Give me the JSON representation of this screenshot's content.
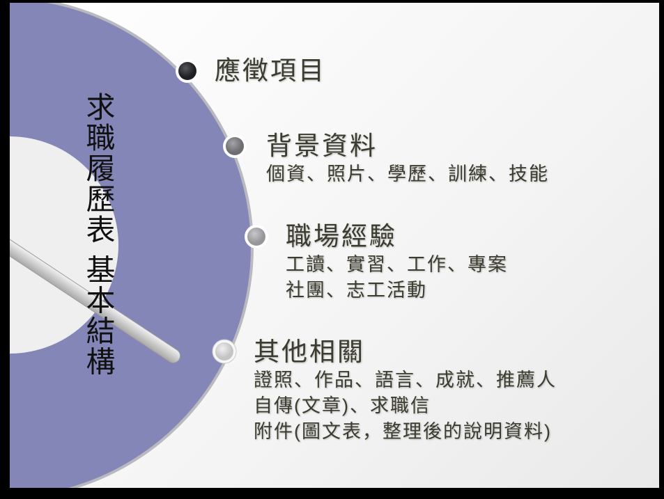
{
  "slide": {
    "vertical_title": "求職履歷表 基本結構",
    "items": [
      {
        "heading": "應徵項目",
        "lines": [],
        "dot_color": "#2a2b30"
      },
      {
        "heading": "背景資料",
        "lines": [
          "個資、照片、學歷、訓練、技能"
        ],
        "dot_color": "#7c7b80"
      },
      {
        "heading": "職場經驗",
        "lines": [
          "工讀、實習、工作、專案",
          "社團、志工活動"
        ],
        "dot_color": "#a9a8ad"
      },
      {
        "heading": "其他相關",
        "lines": [
          "證照、作品、語言、成就、推薦人",
          "自傳(文章)、求職信",
          "附件(圖文表，整理後的說明資料)"
        ],
        "dot_color": "#d6d6d8"
      }
    ],
    "colors": {
      "disc": "#8486b8",
      "text": "#3c3c2e"
    }
  }
}
